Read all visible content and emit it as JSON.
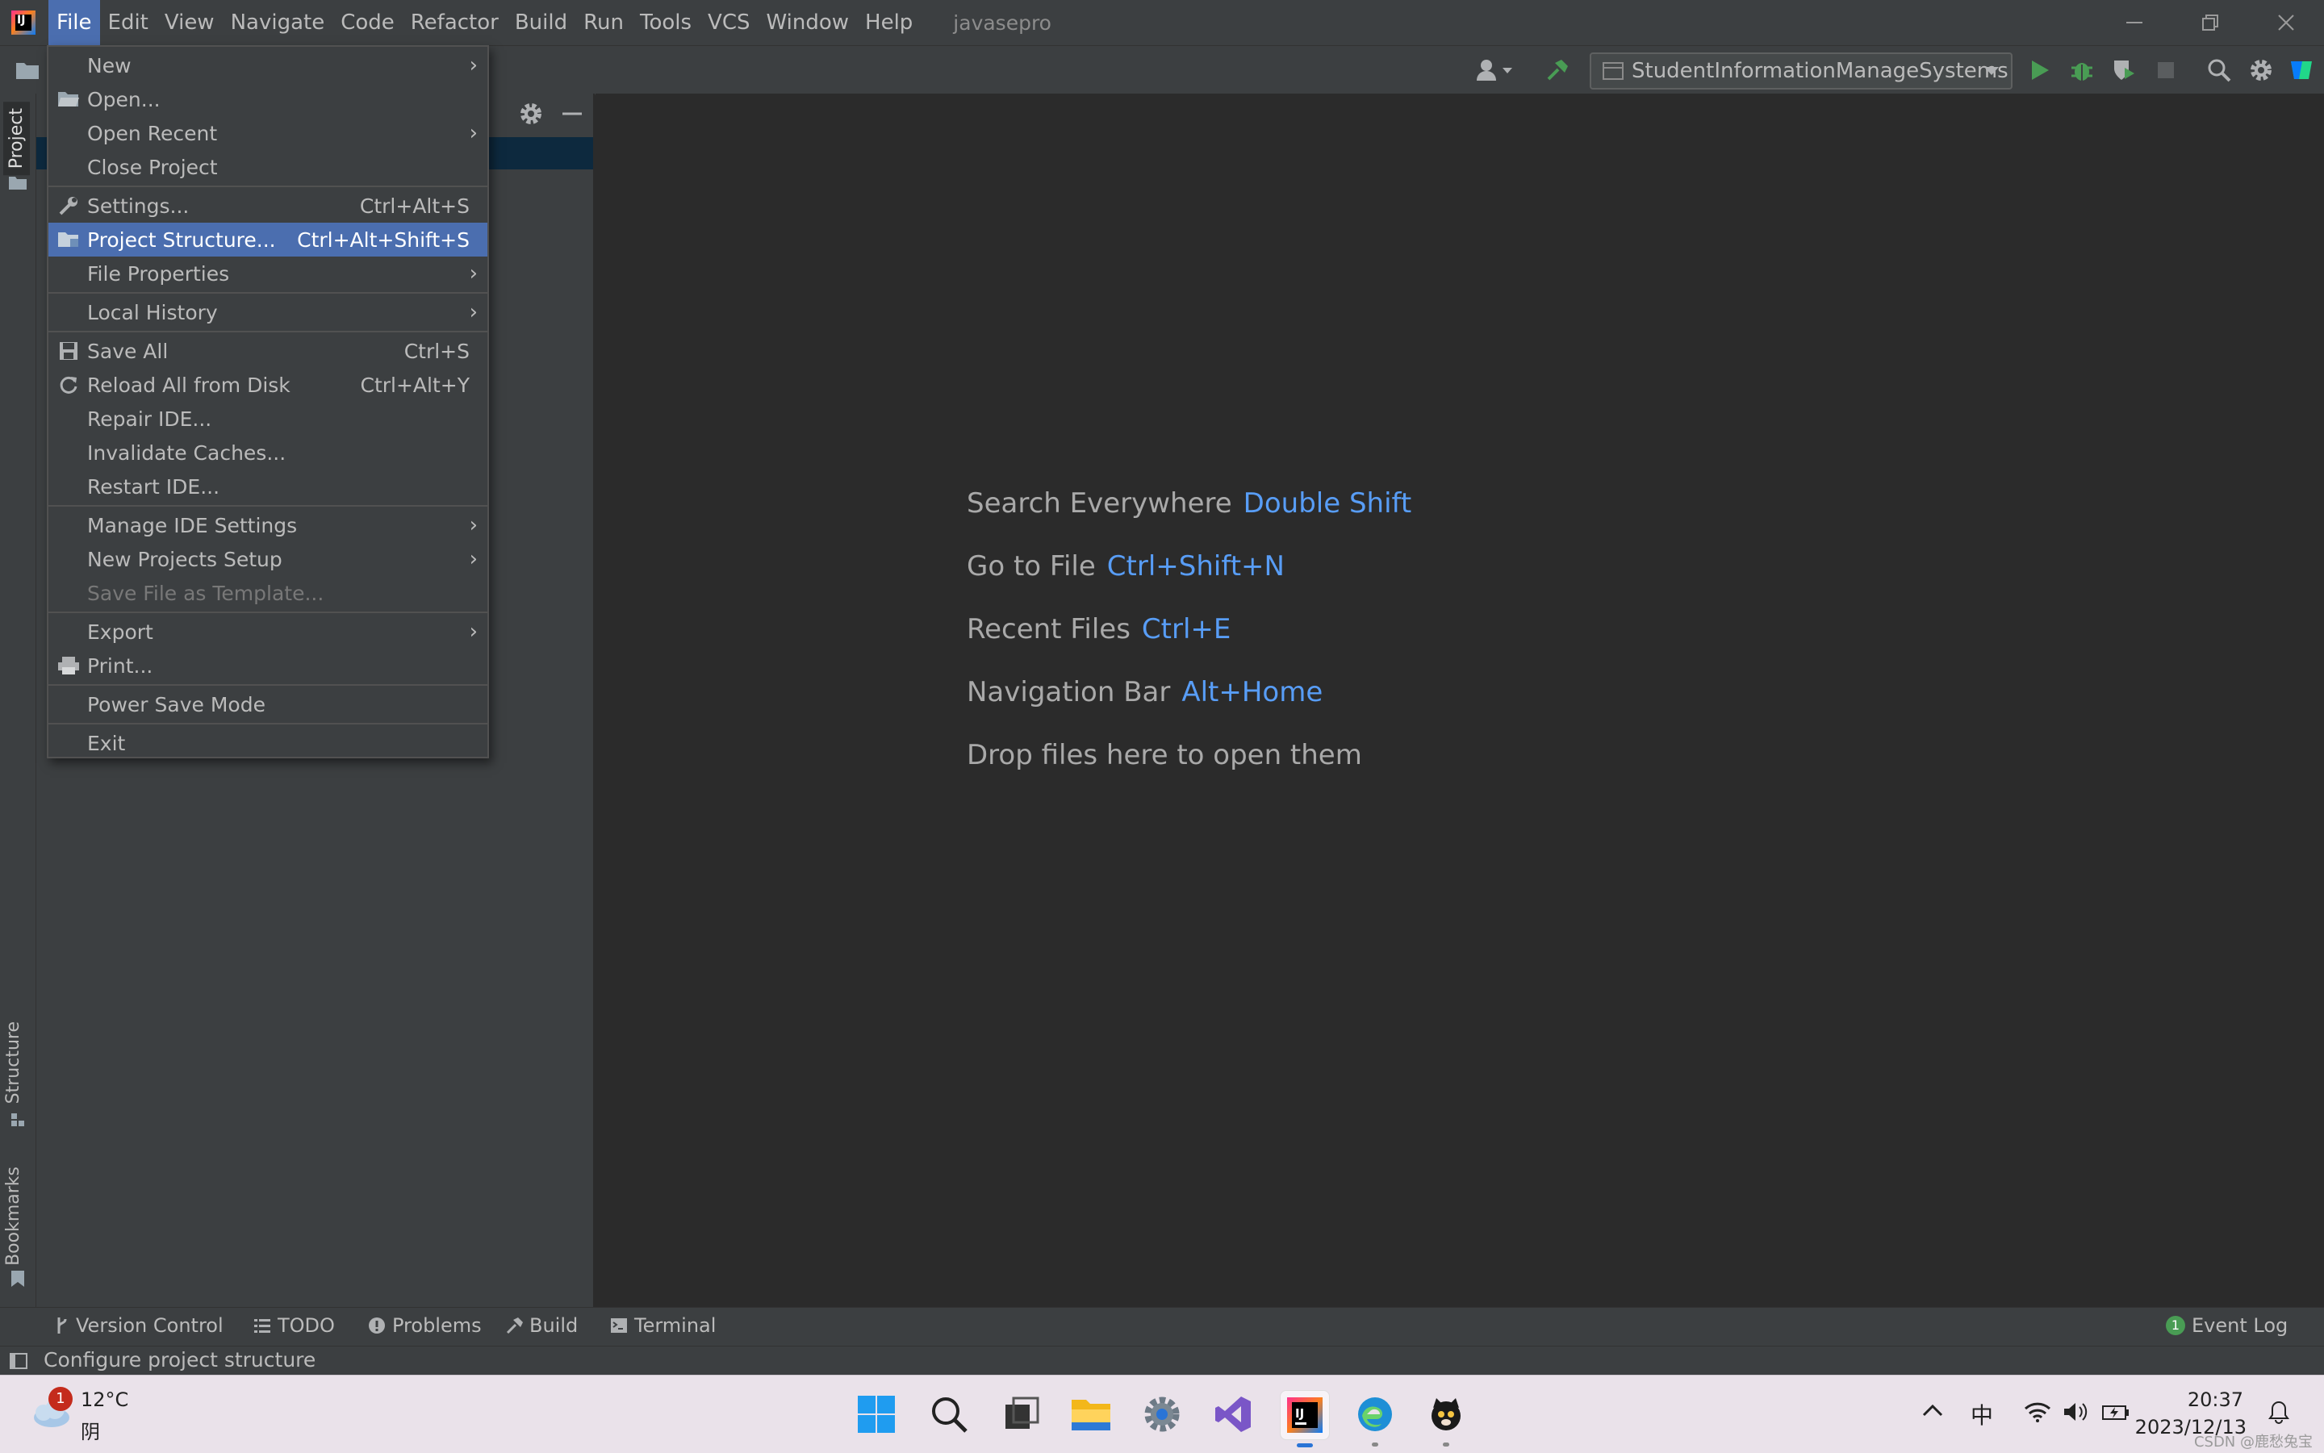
{
  "window": {
    "project_name": "javasepro",
    "logo_text": "IJ"
  },
  "menubar": {
    "items": [
      "File",
      "Edit",
      "View",
      "Navigate",
      "Code",
      "Refactor",
      "Build",
      "Run",
      "Tools",
      "VCS",
      "Window",
      "Help"
    ],
    "active": "File"
  },
  "toolbar": {
    "run_config": "StudentInformationManageSystems"
  },
  "side_tabs": {
    "project": "Project",
    "structure": "Structure",
    "bookmarks": "Bookmarks"
  },
  "file_menu": {
    "new": "New",
    "open": "Open...",
    "open_recent": "Open Recent",
    "close_project": "Close Project",
    "settings": "Settings...",
    "settings_shortcut": "Ctrl+Alt+S",
    "project_structure": "Project Structure...",
    "project_structure_shortcut": "Ctrl+Alt+Shift+S",
    "file_properties": "File Properties",
    "local_history": "Local History",
    "save_all": "Save All",
    "save_all_shortcut": "Ctrl+S",
    "reload": "Reload All from Disk",
    "reload_shortcut": "Ctrl+Alt+Y",
    "repair_ide": "Repair IDE...",
    "invalidate_caches": "Invalidate Caches...",
    "restart_ide": "Restart IDE...",
    "manage_ide_settings": "Manage IDE Settings",
    "new_projects_setup": "New Projects Setup",
    "save_as_template": "Save File as Template...",
    "export": "Export",
    "print": "Print...",
    "power_save": "Power Save Mode",
    "exit": "Exit"
  },
  "editor_hints": {
    "search_label": "Search Everywhere",
    "search_key": "Double Shift",
    "goto_label": "Go to File",
    "goto_key": "Ctrl+Shift+N",
    "recent_label": "Recent Files",
    "recent_key": "Ctrl+E",
    "nav_label": "Navigation Bar",
    "nav_key": "Alt+Home",
    "drop_text": "Drop files here to open them"
  },
  "tool_windows": {
    "version_control": "Version Control",
    "todo": "TODO",
    "problems": "Problems",
    "build": "Build",
    "terminal": "Terminal",
    "event_log": "Event Log",
    "event_log_count": "1"
  },
  "status": {
    "text": "Configure project structure"
  },
  "taskbar": {
    "weather_temp": "12°C",
    "weather_cond": "阴",
    "weather_badge": "1",
    "ime": "中",
    "time": "20:37",
    "date": "2023/12/13",
    "watermark": "CSDN @鹿愁兔宝"
  },
  "colors": {
    "accent": "#4b6eaf",
    "shortcut_blue": "#589df6",
    "run_green": "#499c54"
  }
}
